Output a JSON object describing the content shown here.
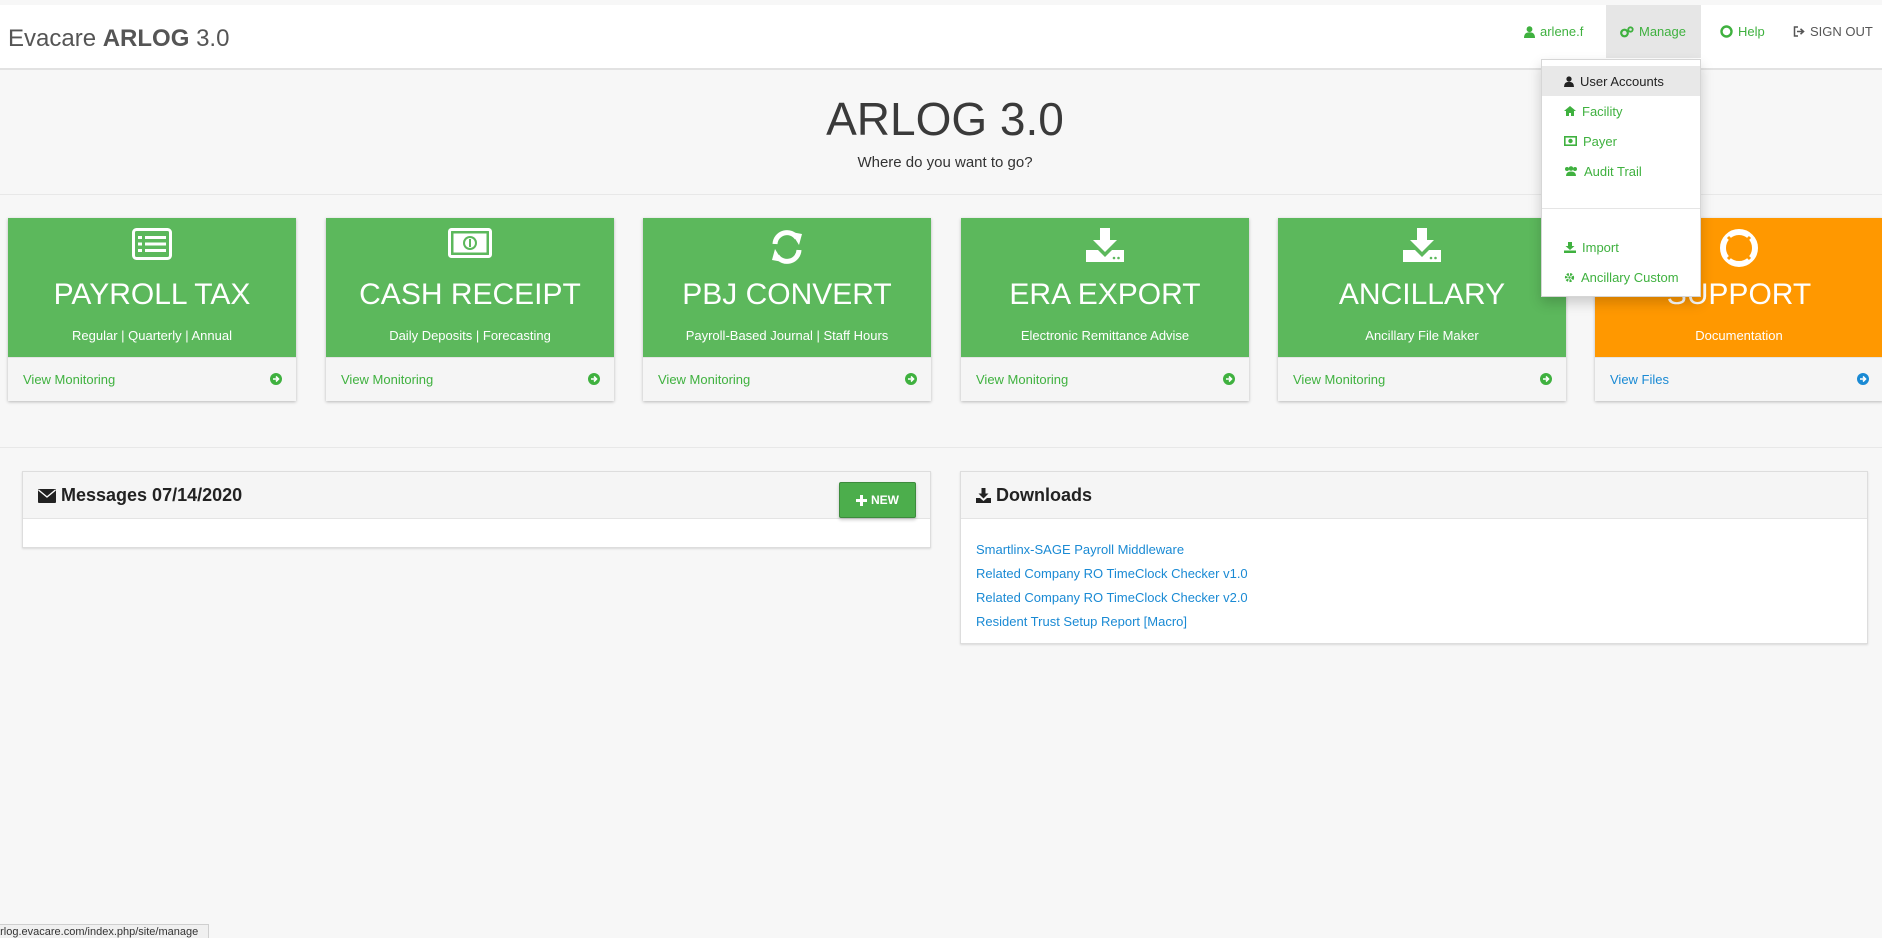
{
  "navbar": {
    "brand_prefix": "Evacare",
    "brand_bold": "ARLOG",
    "brand_suffix": "3.0",
    "user_label": "arlene.f",
    "manage_label": "Manage",
    "help_label": "Help",
    "signout_label": "SIGN OUT",
    "accent_color": "#3fb13f"
  },
  "manage_menu": {
    "items": [
      {
        "label": "User Accounts",
        "icon": "user-icon",
        "active": true
      },
      {
        "label": "Facility",
        "icon": "home-icon"
      },
      {
        "label": "Payer",
        "icon": "money-icon"
      },
      {
        "label": "Audit Trail",
        "icon": "users-icon"
      },
      {
        "label": "Import",
        "icon": "download-icon"
      },
      {
        "label": "Ancillary Custom",
        "icon": "gear-icon"
      }
    ]
  },
  "hero": {
    "title": "ARLOG 3.0",
    "subtitle": "Where do you want to go?"
  },
  "tiles": [
    {
      "title": "PAYROLL TAX",
      "subtitle": "Regular | Quarterly | Annual",
      "link": "View Monitoring",
      "icon": "list-alt-icon",
      "color": "#5cb85c"
    },
    {
      "title": "CASH RECEIPT",
      "subtitle": "Daily Deposits | Forecasting",
      "link": "View Monitoring",
      "icon": "money-icon",
      "color": "#5cb85c"
    },
    {
      "title": "PBJ CONVERT",
      "subtitle": "Payroll-Based Journal | Staff Hours",
      "link": "View Monitoring",
      "icon": "refresh-icon",
      "color": "#5cb85c"
    },
    {
      "title": "ERA EXPORT",
      "subtitle": "Electronic Remittance Advise",
      "link": "View Monitoring",
      "icon": "download-icon",
      "color": "#5cb85c"
    },
    {
      "title": "ANCILLARY",
      "subtitle": "Ancillary File Maker",
      "link": "View Monitoring",
      "icon": "download-icon",
      "color": "#5cb85c"
    },
    {
      "title": "SUPPORT",
      "subtitle": "Documentation",
      "link": "View Files",
      "icon": "life-ring-icon",
      "color": "#ff9800"
    }
  ],
  "messages": {
    "title": "Messages 07/14/2020",
    "new_label": "NEW"
  },
  "downloads": {
    "title": "Downloads",
    "links": [
      "Smartlinx-SAGE Payroll Middleware",
      "Related Company RO TimeClock Checker v1.0",
      "Related Company RO TimeClock Checker v2.0",
      "Resident Trust Setup Report [Macro]"
    ]
  },
  "status_bar": {
    "url": "arlog.evacare.com/index.php/site/manage"
  }
}
